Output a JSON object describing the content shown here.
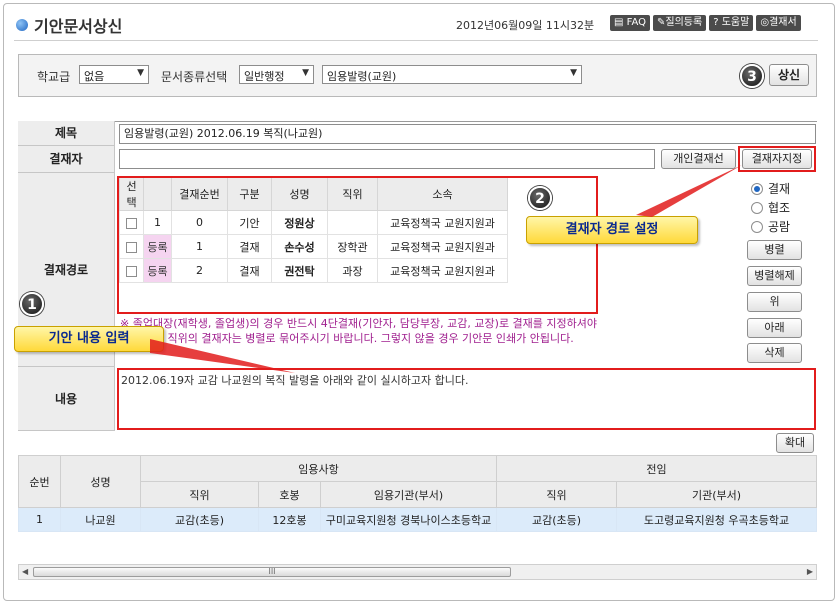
{
  "header": {
    "title": "기안문서상신",
    "datetime": "2012년06월09일 11시32분",
    "links": [
      "FAQ",
      "질의등록",
      "도움말",
      "결재서"
    ]
  },
  "selectbar": {
    "school_level_label": "학교급",
    "school_level_value": "없음",
    "doc_type_label": "문서종류선택",
    "doc_type_value": "일반행정",
    "doc_subtype_value": "임용발령(교원)",
    "submit_label": "상신"
  },
  "form": {
    "title_label": "제목",
    "title_value": "임용발령(교원) 2012.06.19 복직(나교원)",
    "approver_label": "결재자",
    "approver_value": "",
    "personal_approval_btn": "개인결재선",
    "assign_approver_btn": "결재자지정",
    "path_label": "결재경로",
    "content_label": "내용",
    "content_value": "2012.06.19자 교감 나교원의 복직 발령을 아래와 같이 실시하고자 합니다.",
    "expand_btn": "확대"
  },
  "approval_table": {
    "headers": [
      "선택",
      "",
      "결재순번",
      "구분",
      "성명",
      "직위",
      "소속"
    ],
    "rows": [
      {
        "reg": "",
        "seq": "1",
        "order": "0",
        "type": "기안",
        "name": "정원상",
        "position": "",
        "dept": "교육정책국 교원지원과"
      },
      {
        "reg": "등록",
        "seq": "",
        "order": "1",
        "type": "결재",
        "name": "손수성",
        "position": "장학관",
        "dept": "교육정책국 교원지원과"
      },
      {
        "reg": "등록",
        "seq": "",
        "order": "2",
        "type": "결재",
        "name": "권전탁",
        "position": "과장",
        "dept": "교육정책국 교원지원과"
      }
    ]
  },
  "side_options": {
    "radios": [
      "결재",
      "협조",
      "공람"
    ],
    "buttons": [
      "병렬",
      "병렬해제",
      "위",
      "아래",
      "삭제"
    ]
  },
  "notice": "※ 졸업대장(재학생, 졸업생)의 경우 반드시 4단결재(기안자, 담당부장, 교감, 교장)로 결재를 지정하셔야하며 같은 직위의 결재자는 병렬로 묶어주시기 바랍니다. 그렇지 않을 경우 기안문 인쇄가 안됩니다.",
  "callouts": {
    "c1_number": "1",
    "c1_text": "기안 내용 입력",
    "c2_number": "2",
    "c2_text": "결재자 경로 설정",
    "c3_number": "3"
  },
  "grid": {
    "group_headers": {
      "appoint": "임용사항",
      "prev": "전임"
    },
    "columns": [
      "순번",
      "성명",
      "직위",
      "호봉",
      "임용기관(부서)",
      "직위",
      "기관(부서)"
    ],
    "row": [
      "1",
      "나교원",
      "교감(초등)",
      "12호봉",
      "구미교육지원청 경북나이스초등학교",
      "교감(초등)",
      "도고령교육지원청 우곡초등학교"
    ]
  },
  "scrollbar": {
    "grip": "III"
  }
}
